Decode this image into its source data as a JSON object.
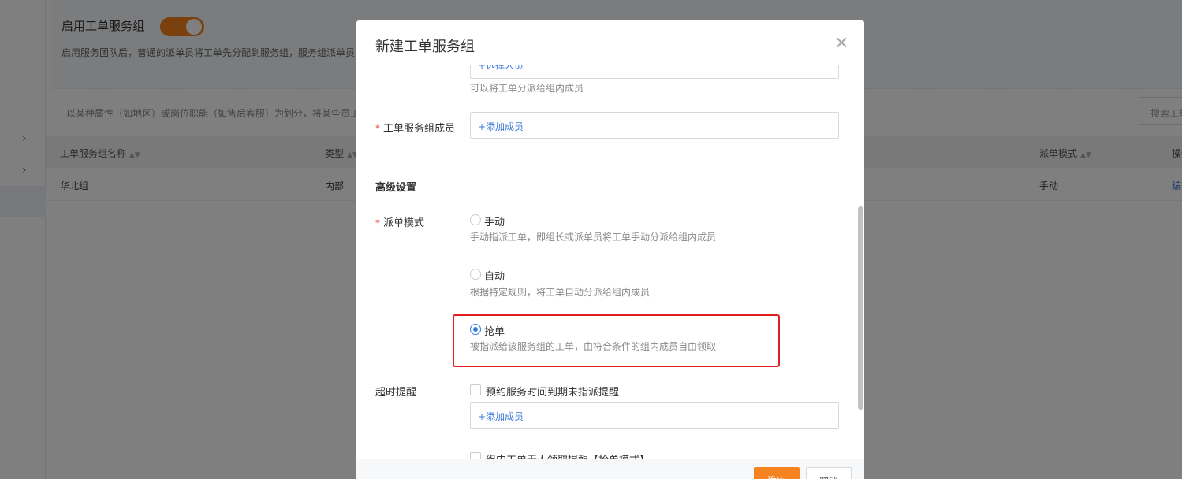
{
  "background": {
    "service_group_toggle": {
      "title": "启用工单服务组",
      "enabled": true,
      "description": "启用服务团队后，普通的派单员将工单先分配到服务组，服务组派单员..."
    },
    "description_line": "以某种属性（如地区）或岗位职能（如售后客服）为划分，将某些员工...",
    "search_placeholder": "搜索工单服务组",
    "table": {
      "headers": [
        "工单服务组名称",
        "类型",
        "派单模式",
        "操作"
      ],
      "rows": [
        {
          "name": "华北组",
          "type": "内部",
          "mode": "手动",
          "action": "编辑"
        }
      ]
    }
  },
  "modal": {
    "title": "新建工单服务组",
    "close_icon": "close-icon",
    "top_field": {
      "link": "+选择人员",
      "hint": "可以将工单分派给组内成员"
    },
    "members": {
      "label": "工单服务组成员",
      "required": true,
      "link": "+添加成员"
    },
    "advanced": {
      "title": "高级设置",
      "dispatch_mode": {
        "label": "派单模式",
        "required": true,
        "options": [
          {
            "label": "手动",
            "hint": "手动指派工单，即组长或派单员将工单手动分派给组内成员",
            "selected": false
          },
          {
            "label": "自动",
            "hint": "根据特定规则，将工单自动分派给组内成员",
            "selected": false
          },
          {
            "label": "抢单",
            "hint": "被指派给该服务组的工单，由符合条件的组内成员自由领取",
            "selected": true
          }
        ]
      },
      "timeout": {
        "label": "超时提醒",
        "checkbox1": {
          "label": "预约服务时间到期未指派提醒",
          "checked": false
        },
        "link": "+添加成员",
        "checkbox2": {
          "label": "组内工单无人领取提醒【抢单模式】",
          "checked": false
        }
      }
    },
    "footer": {
      "ok_label": "确定",
      "cancel_label": "取消"
    },
    "highlight_color": "#e02020"
  }
}
